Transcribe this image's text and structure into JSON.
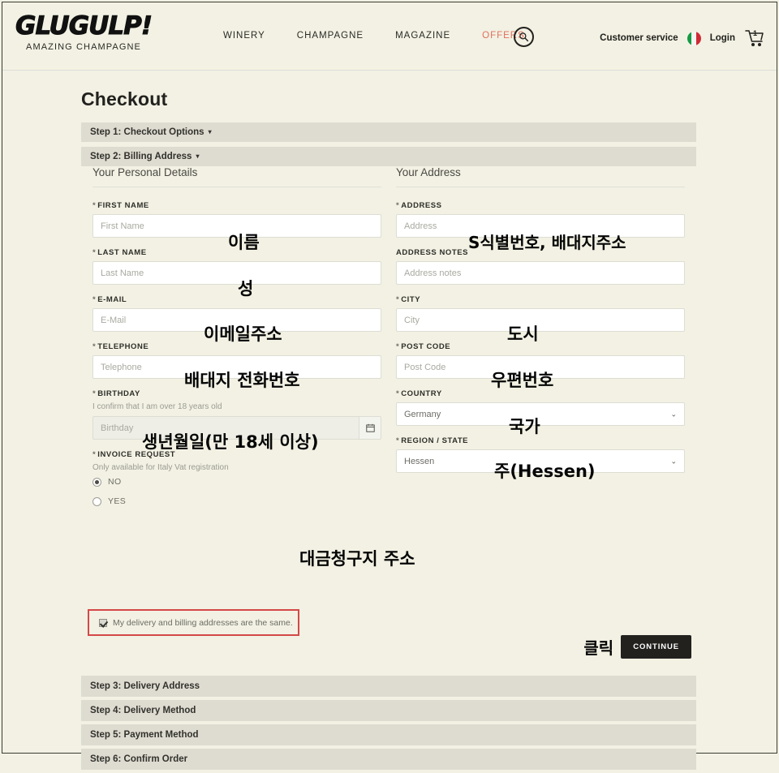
{
  "header": {
    "logo_word": "GLUGULP!",
    "logo_sub": "AMAZING CHAMPAGNE",
    "nav": [
      {
        "label": "WINERY"
      },
      {
        "label": "CHAMPAGNE"
      },
      {
        "label": "MAGAZINE"
      },
      {
        "label": "OFFERS"
      }
    ],
    "search_icon": "search-icon",
    "customer_service": "Customer service",
    "flag_icon": "italy-flag-icon",
    "login": "Login",
    "cart_icon": "shopping-cart-icon",
    "cart_count": "1",
    "accent_color": "#e0705e"
  },
  "page": {
    "title": "Checkout"
  },
  "steps_top": [
    {
      "label": "Step 1: Checkout Options",
      "caret": "▾"
    },
    {
      "label": "Step 2: Billing Address",
      "caret": "▾"
    }
  ],
  "steps_bottom": [
    {
      "label": "Step 3: Delivery Address"
    },
    {
      "label": "Step 4: Delivery Method"
    },
    {
      "label": "Step 5: Payment Method"
    },
    {
      "label": "Step 6: Confirm Order"
    }
  ],
  "personal": {
    "section_title": "Your Personal Details",
    "first_name": {
      "label": "FIRST NAME",
      "required": "*",
      "placeholder": "First Name",
      "value": "",
      "annotation": "이름"
    },
    "last_name": {
      "label": "LAST NAME",
      "required": "*",
      "placeholder": "Last Name",
      "value": "",
      "annotation": "성"
    },
    "email": {
      "label": "E-MAIL",
      "required": "*",
      "placeholder": "E-Mail",
      "value": "",
      "annotation": "이메일주소"
    },
    "telephone": {
      "label": "TELEPHONE",
      "required": "*",
      "placeholder": "Telephone",
      "value": "",
      "annotation": "배대지 전화번호"
    },
    "birthday": {
      "label": "BIRTHDAY",
      "required": "*",
      "hint": "I confirm that I am over 18 years old",
      "placeholder": "Birthday",
      "value": "",
      "calendar_icon": "calendar-icon",
      "annotation": "생년월일(만 18세 이상)"
    },
    "invoice": {
      "label": "INVOICE REQUEST",
      "required": "*",
      "hint": "Only available for Italy Vat registration",
      "options": [
        {
          "label": "NO",
          "selected": true
        },
        {
          "label": "YES",
          "selected": false
        }
      ]
    }
  },
  "address": {
    "section_title": "Your Address",
    "address": {
      "label": "ADDRESS",
      "required": "*",
      "placeholder": "Address",
      "value": "",
      "annotation": "S식별번호, 배대지주소"
    },
    "address_notes": {
      "label": "ADDRESS NOTES",
      "required": "",
      "placeholder": "Address notes",
      "value": "",
      "annotation": ""
    },
    "city": {
      "label": "CITY",
      "required": "*",
      "placeholder": "City",
      "value": "",
      "annotation": "도시"
    },
    "post_code": {
      "label": "POST CODE",
      "required": "*",
      "placeholder": "Post Code",
      "value": "",
      "annotation": "우편번호"
    },
    "country": {
      "label": "COUNTRY",
      "required": "*",
      "value": "Germany",
      "annotation": "국가",
      "chevron": "⌄"
    },
    "region": {
      "label": "REGION / STATE",
      "required": "*",
      "value": "Hessen",
      "annotation": "주(Hessen)",
      "chevron": "⌄"
    }
  },
  "same_address": {
    "checkbox_label": "My delivery and billing addresses are the same.",
    "checked": true,
    "annotation": "대금청구지 주소",
    "highlight_color": "#d44848"
  },
  "continue": {
    "annotation": "클릭",
    "button_label": "CONTINUE"
  }
}
